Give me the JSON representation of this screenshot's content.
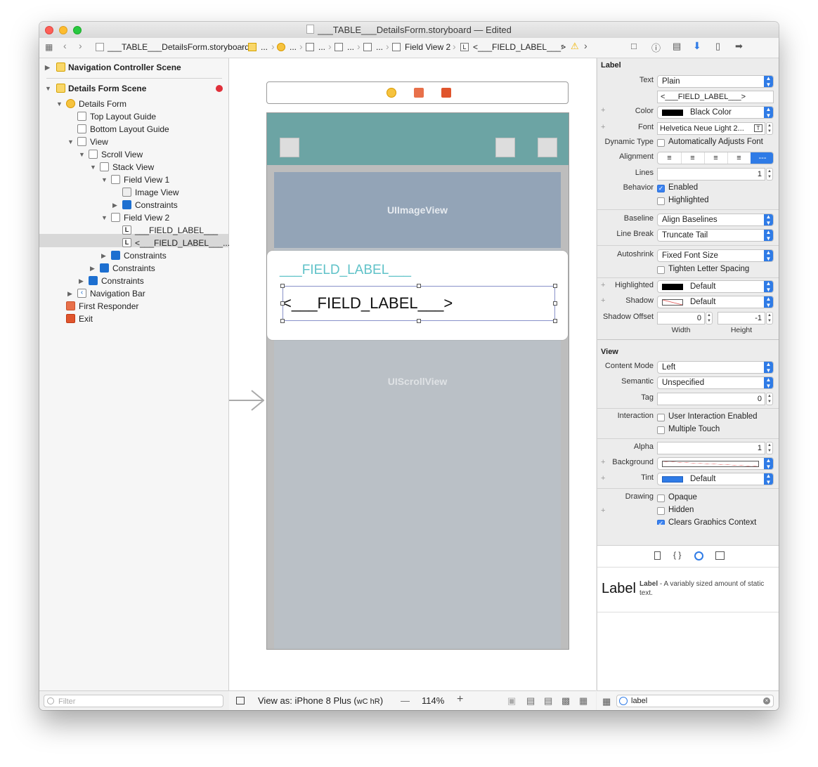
{
  "window": {
    "title": "___TABLE___DetailsForm.storyboard — Edited",
    "close_color": "#fd5f57",
    "minimize_color": "#fdbc2e",
    "zoom_color": "#28c840"
  },
  "jumpbar": {
    "file": "___TABLE___DetailsForm.storyboard",
    "ellipsis": "...",
    "field_view": "Field View 2",
    "label_item": "<___FIELD_LABEL___>"
  },
  "navigator": {
    "rows": [
      "Navigation Controller Scene",
      "Details Form Scene",
      "Details Form",
      "Top Layout Guide",
      "Bottom Layout Guide",
      "View",
      "Scroll View",
      "Stack View",
      "Field View 1",
      "Image View",
      "Constraints",
      "Field View 2",
      "___FIELD_LABEL___",
      "<___FIELD_LABEL___...",
      "Constraints",
      "Constraints",
      "Constraints",
      "Navigation Bar",
      "First Responder",
      "Exit"
    ],
    "filter_placeholder": "Filter"
  },
  "canvas": {
    "image_view_label": "UIImageView",
    "field_label_1": "___FIELD_LABEL___",
    "field_label_2": "<___FIELD_LABEL___>",
    "scroll_view_label": "UIScrollView",
    "navbar_color": "#6ca4a4",
    "accent_teal": "#5fc2c8"
  },
  "bottombar": {
    "view_as": "View as: iPhone 8 Plus (",
    "size_class": "wC hR",
    "close_paren": ")",
    "minus": "—",
    "zoom": "114%",
    "plus": "+"
  },
  "inspector": {
    "label_section": "Label",
    "text_label": "Text",
    "text_value": "Plain",
    "text_content": "<___FIELD_LABEL___>",
    "color_label": "Color",
    "color_value": "Black Color",
    "font_label": "Font",
    "font_value": "Helvetica Neue Light 2...",
    "dynamic_type_label": "Dynamic Type",
    "dynamic_type_value": "Automatically Adjusts Font",
    "alignment_label": "Alignment",
    "lines_label": "Lines",
    "lines_value": "1",
    "behavior_label": "Behavior",
    "enabled": "Enabled",
    "highlighted_chk": "Highlighted",
    "baseline_label": "Baseline",
    "baseline_value": "Align Baselines",
    "line_break_label": "Line Break",
    "line_break_value": "Truncate Tail",
    "autoshrink_label": "Autoshrink",
    "autoshrink_value": "Fixed Font Size",
    "tighten": "Tighten Letter Spacing",
    "highlighted_label": "Highlighted",
    "highlighted_value": "Default",
    "shadow_label": "Shadow",
    "shadow_value": "Default",
    "shadow_offset_label": "Shadow Offset",
    "shadow_w": "0",
    "shadow_h": "-1",
    "width": "Width",
    "height": "Height",
    "view_section": "View",
    "content_mode_label": "Content Mode",
    "content_mode_value": "Left",
    "semantic_label": "Semantic",
    "semantic_value": "Unspecified",
    "tag_label": "Tag",
    "tag_value": "0",
    "interaction_label": "Interaction",
    "user_interaction": "User Interaction Enabled",
    "multiple_touch": "Multiple Touch",
    "alpha_label": "Alpha",
    "alpha_value": "1",
    "background_label": "Background",
    "tint_label": "Tint",
    "tint_value": "Default",
    "drawing_label": "Drawing",
    "opaque": "Opaque",
    "hidden": "Hidden",
    "clears": "Clears Graphics Context",
    "tint_color": "#2f7be6"
  },
  "library": {
    "big": "Label",
    "title": "Label",
    "desc": " - A variably sized amount of static text."
  },
  "library_search": {
    "value": "label"
  }
}
